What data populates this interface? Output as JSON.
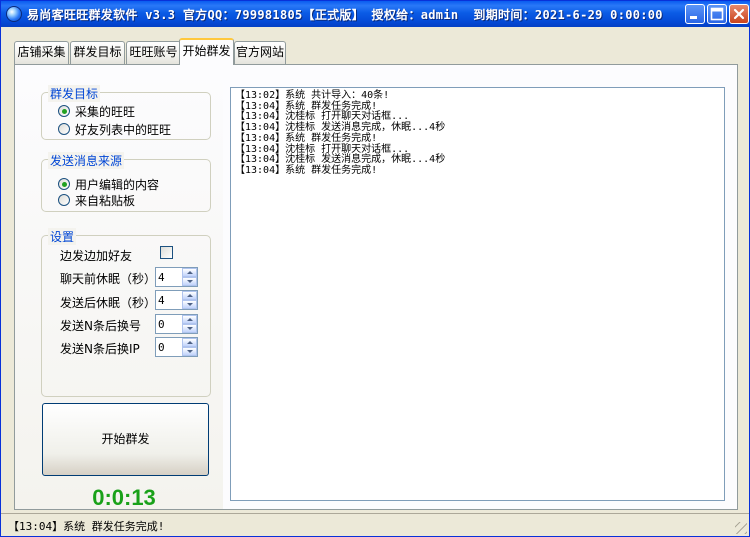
{
  "window": {
    "title": "易尚客旺旺群发软件 v3.3 官方QQ：799981805【正式版】 授权给：admin  到期时间：2021-6-29 0:00:00"
  },
  "tabs": [
    {
      "label": "店铺采集",
      "active": false
    },
    {
      "label": "群发目标",
      "active": false
    },
    {
      "label": "旺旺账号",
      "active": false
    },
    {
      "label": "开始群发",
      "active": true
    },
    {
      "label": "官方网站",
      "active": false
    }
  ],
  "target_group": {
    "title": "群发目标",
    "options": [
      {
        "label": "采集的旺旺",
        "selected": true
      },
      {
        "label": "好友列表中的旺旺",
        "selected": false
      }
    ]
  },
  "source_group": {
    "title": "发送消息来源",
    "options": [
      {
        "label": "用户编辑的内容",
        "selected": true
      },
      {
        "label": "来自粘贴板",
        "selected": false
      }
    ]
  },
  "settings_group": {
    "title": "设置",
    "add_friend": {
      "label": "边发边加好友",
      "checked": false
    },
    "fields": [
      {
        "label": "聊天前休眠（秒）",
        "value": "4"
      },
      {
        "label": "发送后休眠（秒）",
        "value": "4"
      },
      {
        "label": "发送N条后换号",
        "value": "0"
      },
      {
        "label": "发送N条后换IP",
        "value": "0"
      }
    ]
  },
  "start_button": {
    "label": "开始群发"
  },
  "timer": "0:0:13",
  "log": [
    "【13:02】系统 共计导入：40条!",
    "【13:04】系统 群发任务完成!",
    "【13:04】沈桂标 打开聊天对话框...",
    "【13:04】沈桂标 发送消息完成，休眠...4秒",
    "【13:04】系统 群发任务完成!",
    "【13:04】沈桂标 打开聊天对话框...",
    "【13:04】沈桂标 发送消息完成，休眠...4秒",
    "【13:04】系统 群发任务完成!"
  ],
  "status": "【13:04】系统 群发任务完成!",
  "colors": {
    "title_bar": "#0b5ce6",
    "group_title": "#0046d5",
    "timer": "#19a119",
    "active_tab_accent": "#ffc83c"
  }
}
